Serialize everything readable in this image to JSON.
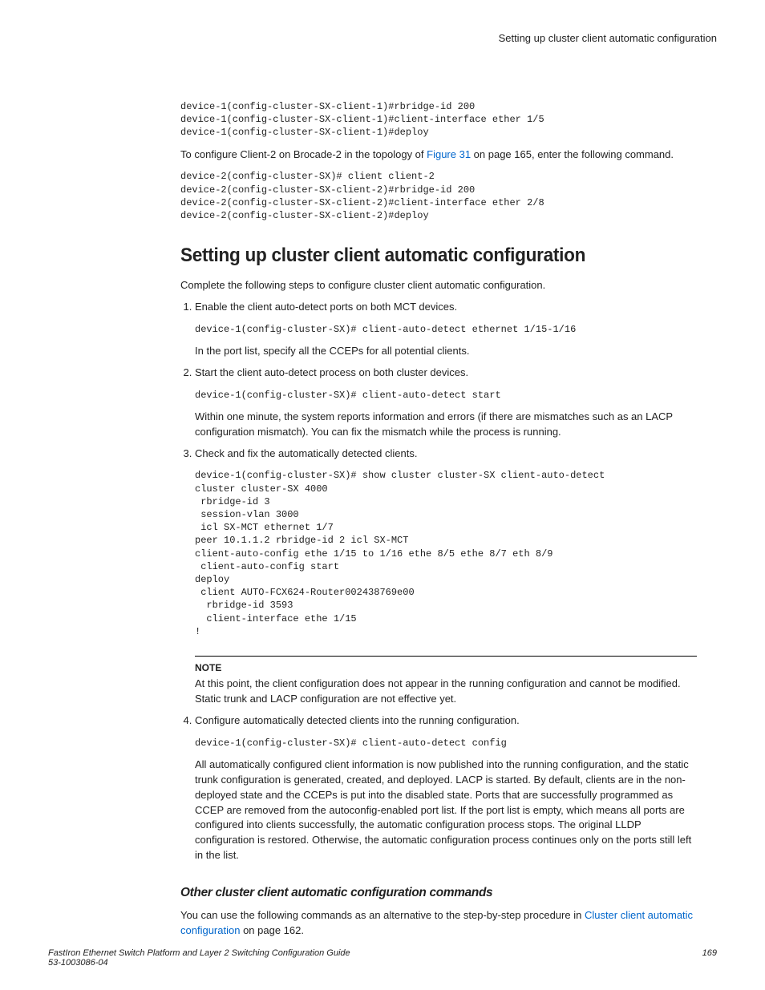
{
  "header": {
    "title": "Setting up cluster client automatic configuration"
  },
  "block1": {
    "code": "device-1(config-cluster-SX-client-1)#rbridge-id 200\ndevice-1(config-cluster-SX-client-1)#client-interface ether 1/5\ndevice-1(config-cluster-SX-client-1)#deploy",
    "intro_before_link": "To configure Client-2 on Brocade-2 in the topology of ",
    "link": "Figure 31",
    "intro_after_link": " on page 165, enter the following command.",
    "code2": "device-2(config-cluster-SX)# client client-2\ndevice-2(config-cluster-SX-client-2)#rbridge-id 200\ndevice-2(config-cluster-SX-client-2)#client-interface ether 2/8\ndevice-2(config-cluster-SX-client-2)#deploy"
  },
  "section": {
    "heading": "Setting up cluster client automatic configuration",
    "intro": "Complete the following steps to configure cluster client automatic configuration.",
    "step1": {
      "text": "Enable the client auto-detect ports on both MCT devices.",
      "code": "device-1(config-cluster-SX)# client-auto-detect ethernet 1/15-1/16",
      "after": "In the port list, specify all the CCEPs for all potential clients."
    },
    "step2": {
      "text": "Start the client auto-detect process on both cluster devices.",
      "code": "device-1(config-cluster-SX)# client-auto-detect start",
      "after": "Within one minute, the system reports information and errors (if there are mismatches such as an LACP configuration mismatch). You can fix the mismatch while the process is running."
    },
    "step3": {
      "text": "Check and fix the automatically detected clients.",
      "code": "device-1(config-cluster-SX)# show cluster cluster-SX client-auto-detect\ncluster cluster-SX 4000\n rbridge-id 3\n session-vlan 3000\n icl SX-MCT ethernet 1/7\npeer 10.1.1.2 rbridge-id 2 icl SX-MCT\nclient-auto-config ethe 1/15 to 1/16 ethe 8/5 ethe 8/7 eth 8/9\n client-auto-config start\ndeploy\n client AUTO-FCX624-Router002438769e00\n  rbridge-id 3593\n  client-interface ethe 1/15\n!",
      "note_label": "NOTE",
      "note_text": "At this point, the client configuration does not appear in the running configuration and cannot be modified. Static trunk and LACP configuration are not effective yet."
    },
    "step4": {
      "text": "Configure automatically detected clients into the running configuration.",
      "code": "device-1(config-cluster-SX)# client-auto-detect config",
      "after": "All automatically configured client information is now published into the running configuration, and the static trunk configuration is generated, created, and deployed. LACP is started. By default, clients are in the non-deployed state and the CCEPs is put into the disabled state. Ports that are successfully programmed as CCEP are removed from the autoconfig-enabled port list. If the port list is empty, which means all ports are configured into clients successfully, the automatic configuration process stops. The original LLDP configuration is restored. Otherwise, the automatic configuration process continues only on the ports still left in the list."
    }
  },
  "subsection": {
    "heading": "Other cluster client automatic configuration commands",
    "text_before_link": "You can use the following commands as an alternative to the step-by-step procedure in ",
    "link": "Cluster client automatic configuration",
    "text_after_link": " on page 162."
  },
  "footer": {
    "left_line1": "FastIron Ethernet Switch Platform and Layer 2 Switching Configuration Guide",
    "left_line2": "53-1003086-04",
    "right": "169"
  }
}
